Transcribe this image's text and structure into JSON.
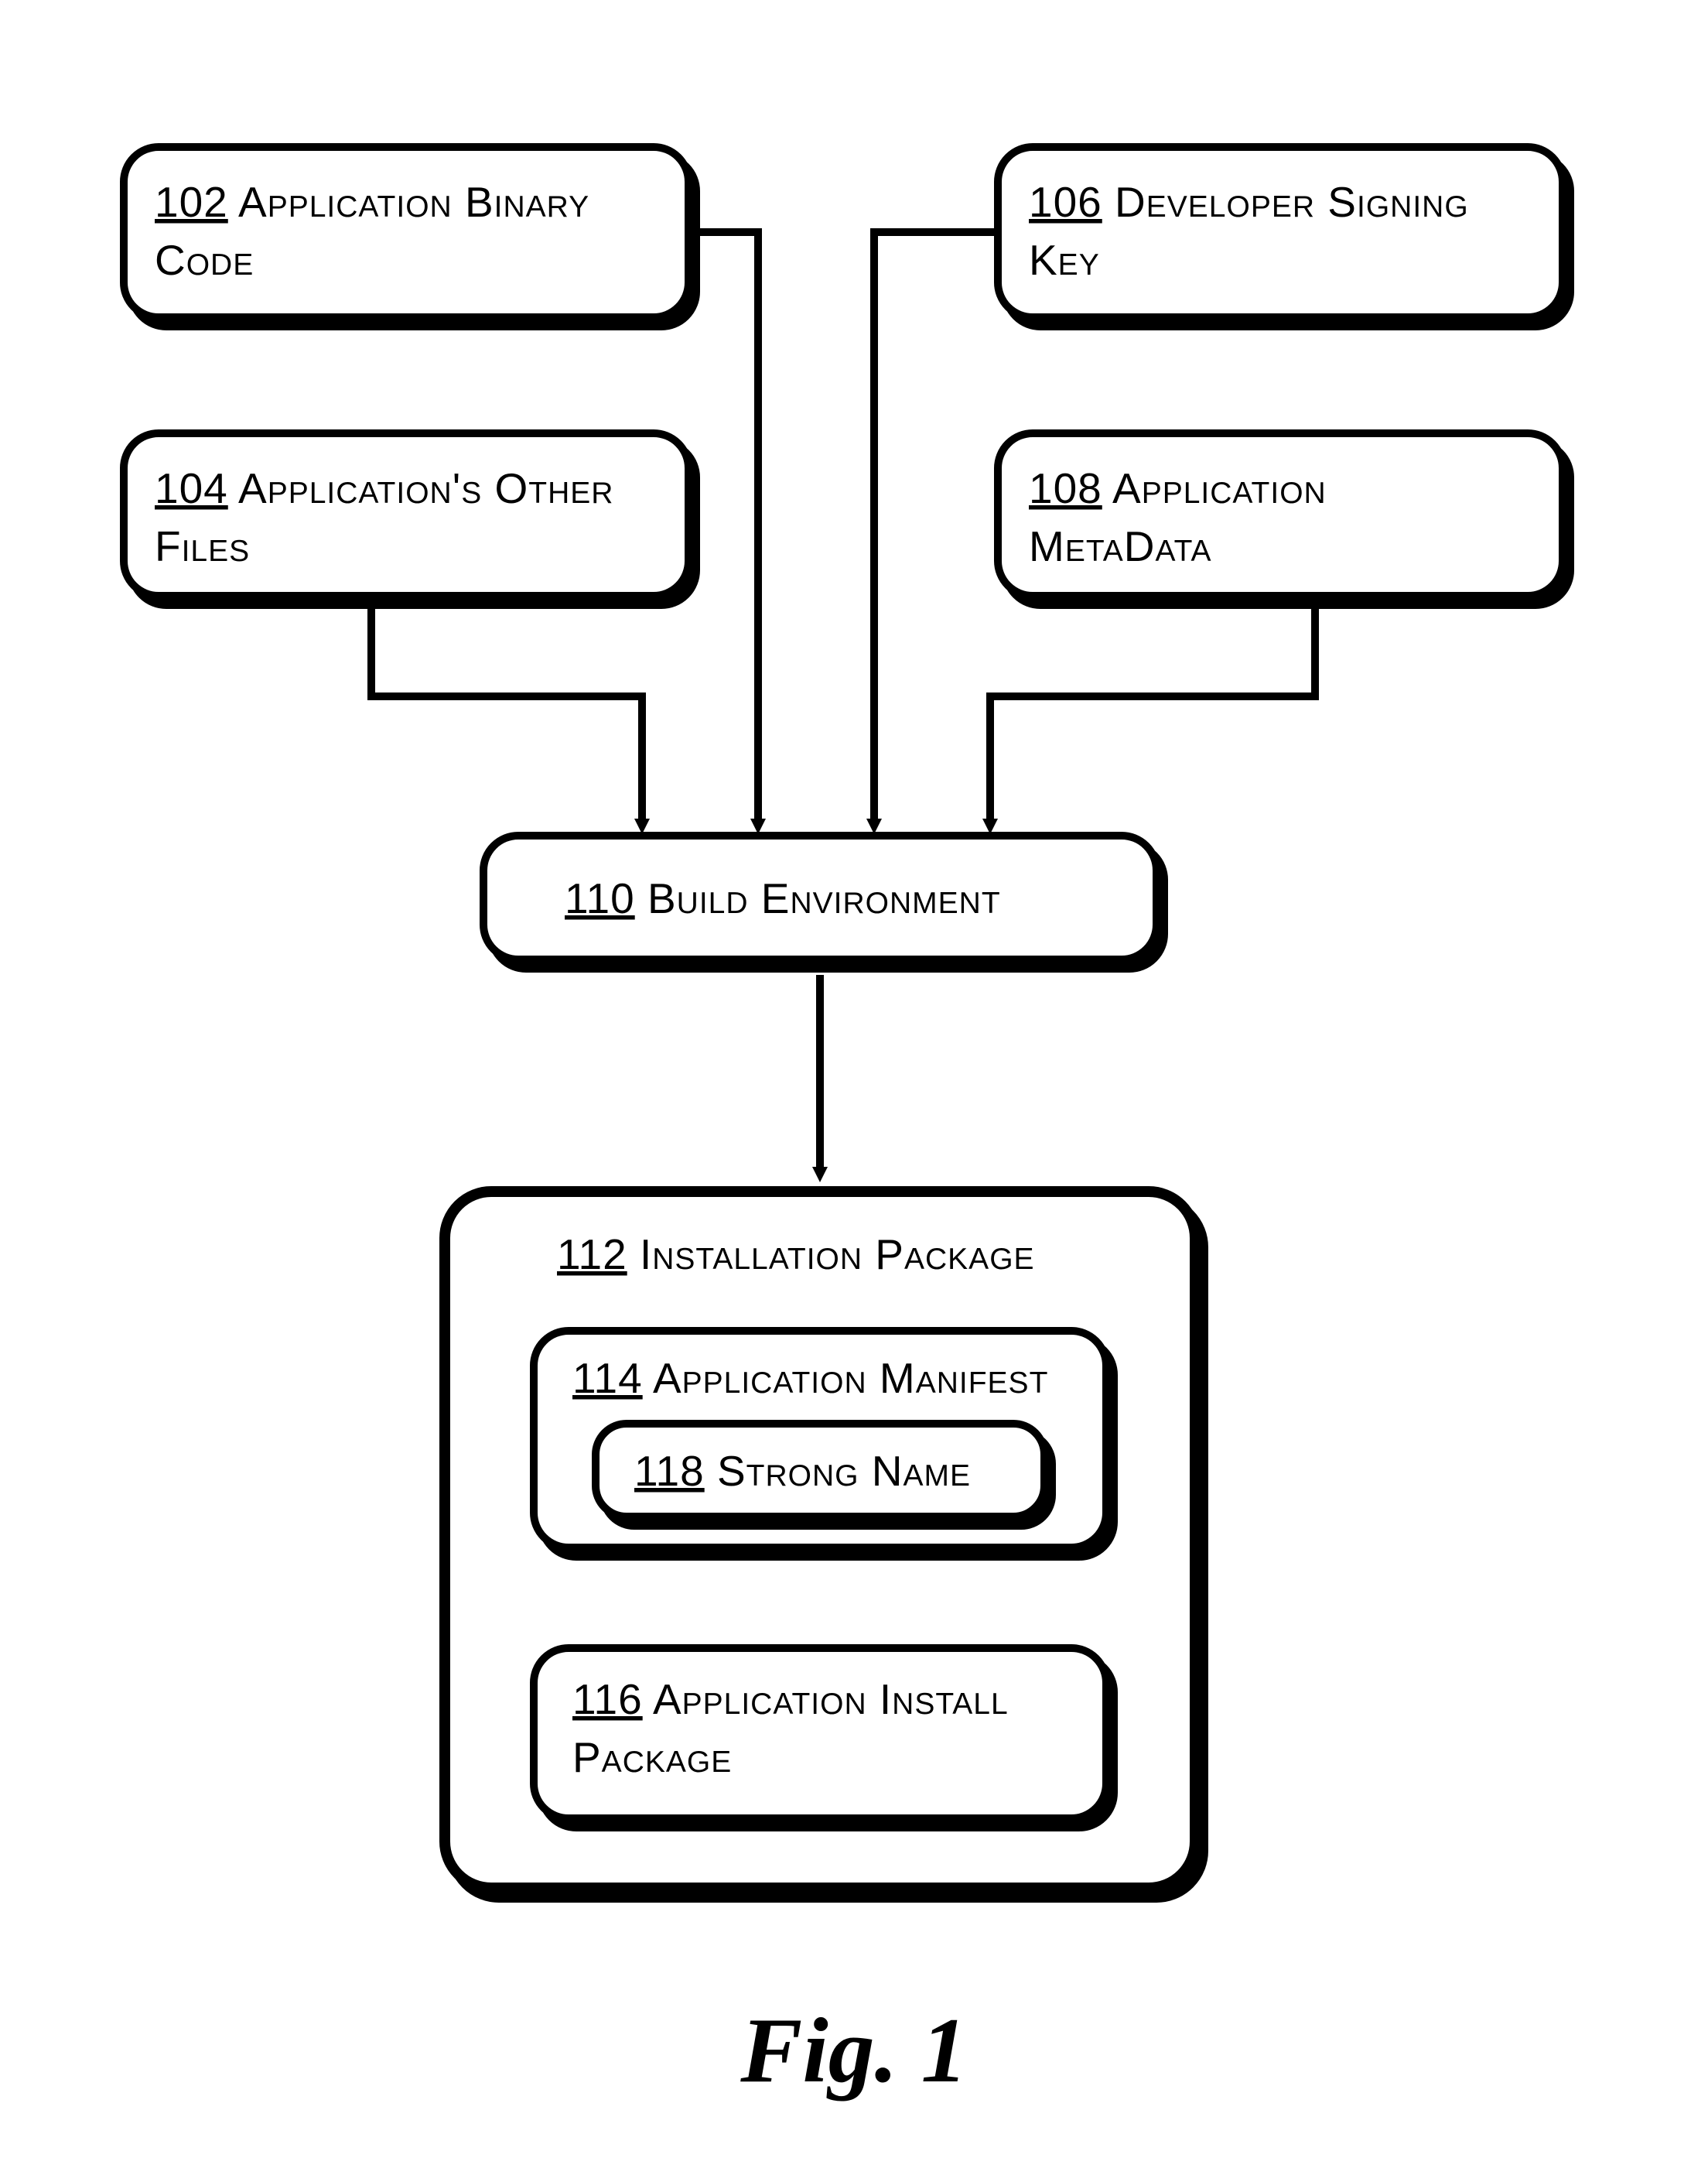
{
  "nodes": {
    "n102": {
      "ref": "102",
      "label": "Application Binary Code"
    },
    "n104": {
      "ref": "104",
      "label": "Application's Other Files"
    },
    "n106": {
      "ref": "106",
      "label": "Developer Signing Key"
    },
    "n108": {
      "ref": "108",
      "label": "Application MetaData"
    },
    "n110": {
      "ref": "110",
      "label": "Build Environment"
    },
    "n112": {
      "ref": "112",
      "label": "Installation Package"
    },
    "n114": {
      "ref": "114",
      "label": "Application Manifest"
    },
    "n118": {
      "ref": "118",
      "label": "Strong Name"
    },
    "n116": {
      "ref": "116",
      "label": "Application Install Package"
    }
  },
  "figure_caption": "Fig. 1"
}
